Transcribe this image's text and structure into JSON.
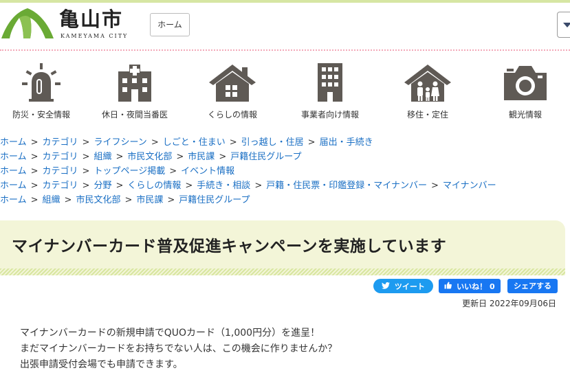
{
  "header": {
    "logo_kanji": "亀山市",
    "logo_roman": "KAMEYAMA CITY",
    "home_button": "ホーム"
  },
  "nav": {
    "items": [
      {
        "label": "防災・安全情報",
        "icon": "siren-icon"
      },
      {
        "label": "休日・夜間当番医",
        "icon": "hospital-icon"
      },
      {
        "label": "くらしの情報",
        "icon": "house-icon"
      },
      {
        "label": "事業者向け情報",
        "icon": "building-icon"
      },
      {
        "label": "移住・定住",
        "icon": "family-house-icon"
      },
      {
        "label": "観光情報",
        "icon": "camera-icon"
      }
    ],
    "icon_color": "#5f5a55"
  },
  "breadcrumbs": [
    [
      "ホーム",
      "カテゴリ",
      "ライフシーン",
      "しごと・住まい",
      "引っ越し・住居",
      "届出・手続き"
    ],
    [
      "ホーム",
      "カテゴリ",
      "組織",
      "市民文化部",
      "市民課",
      "戸籍住民グループ"
    ],
    [
      "ホーム",
      "カテゴリ",
      "トップページ掲載",
      "イベント情報"
    ],
    [
      "ホーム",
      "カテゴリ",
      "分野",
      "くらしの情報",
      "手続き・相談",
      "戸籍・住民票・印鑑登録・マイナンバー",
      "マイナンバー"
    ],
    [
      "ホーム",
      "組織",
      "市民文化部",
      "市民課",
      "戸籍住民グループ"
    ]
  ],
  "breadcrumb_separator": ">",
  "page": {
    "title": "マイナンバーカード普及促進キャンペーンを実施しています",
    "tweet_label": "ツイート",
    "like_label": "いいね！ 0",
    "share_label": "シェアする",
    "updated": "更新日 2022年09月06日",
    "body_lines": [
      "マイナンバーカードの新規申請でQUOカード（1,000円分）を進呈！",
      "まだマイナンバーカードをお持ちでない人は、この機会に作りませんか？",
      "出張申請受付会場でも申請できます。"
    ]
  },
  "colors": {
    "link": "#1a6fc4",
    "logo_green": "#6aaa35",
    "title_bg": "#f3f5d8",
    "twitter": "#1d9bf0",
    "facebook": "#1877f2"
  }
}
